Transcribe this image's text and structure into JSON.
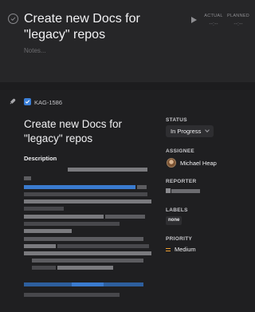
{
  "task": {
    "title": "Create new Docs for \"legacy\" repos",
    "notes_placeholder": "Notes...",
    "actual_label": "ACTUAL",
    "actual_value": "--:--",
    "planned_label": "PLANNED",
    "planned_value": "--:--"
  },
  "issue": {
    "key": "KAG-1586",
    "title": "Create new Docs for \"legacy\" repos",
    "description_label": "Description"
  },
  "sidebar": {
    "status_label": "STATUS",
    "status_value": "In Progress",
    "assignee_label": "ASSIGNEE",
    "assignee_name": "Michael Heap",
    "reporter_label": "REPORTER",
    "labels_label": "LABELS",
    "labels_value": "none",
    "priority_label": "PRIORITY",
    "priority_value": "Medium"
  },
  "colors": {
    "accent_blue": "#3b7fd8",
    "priority_medium": "#f0a030"
  }
}
